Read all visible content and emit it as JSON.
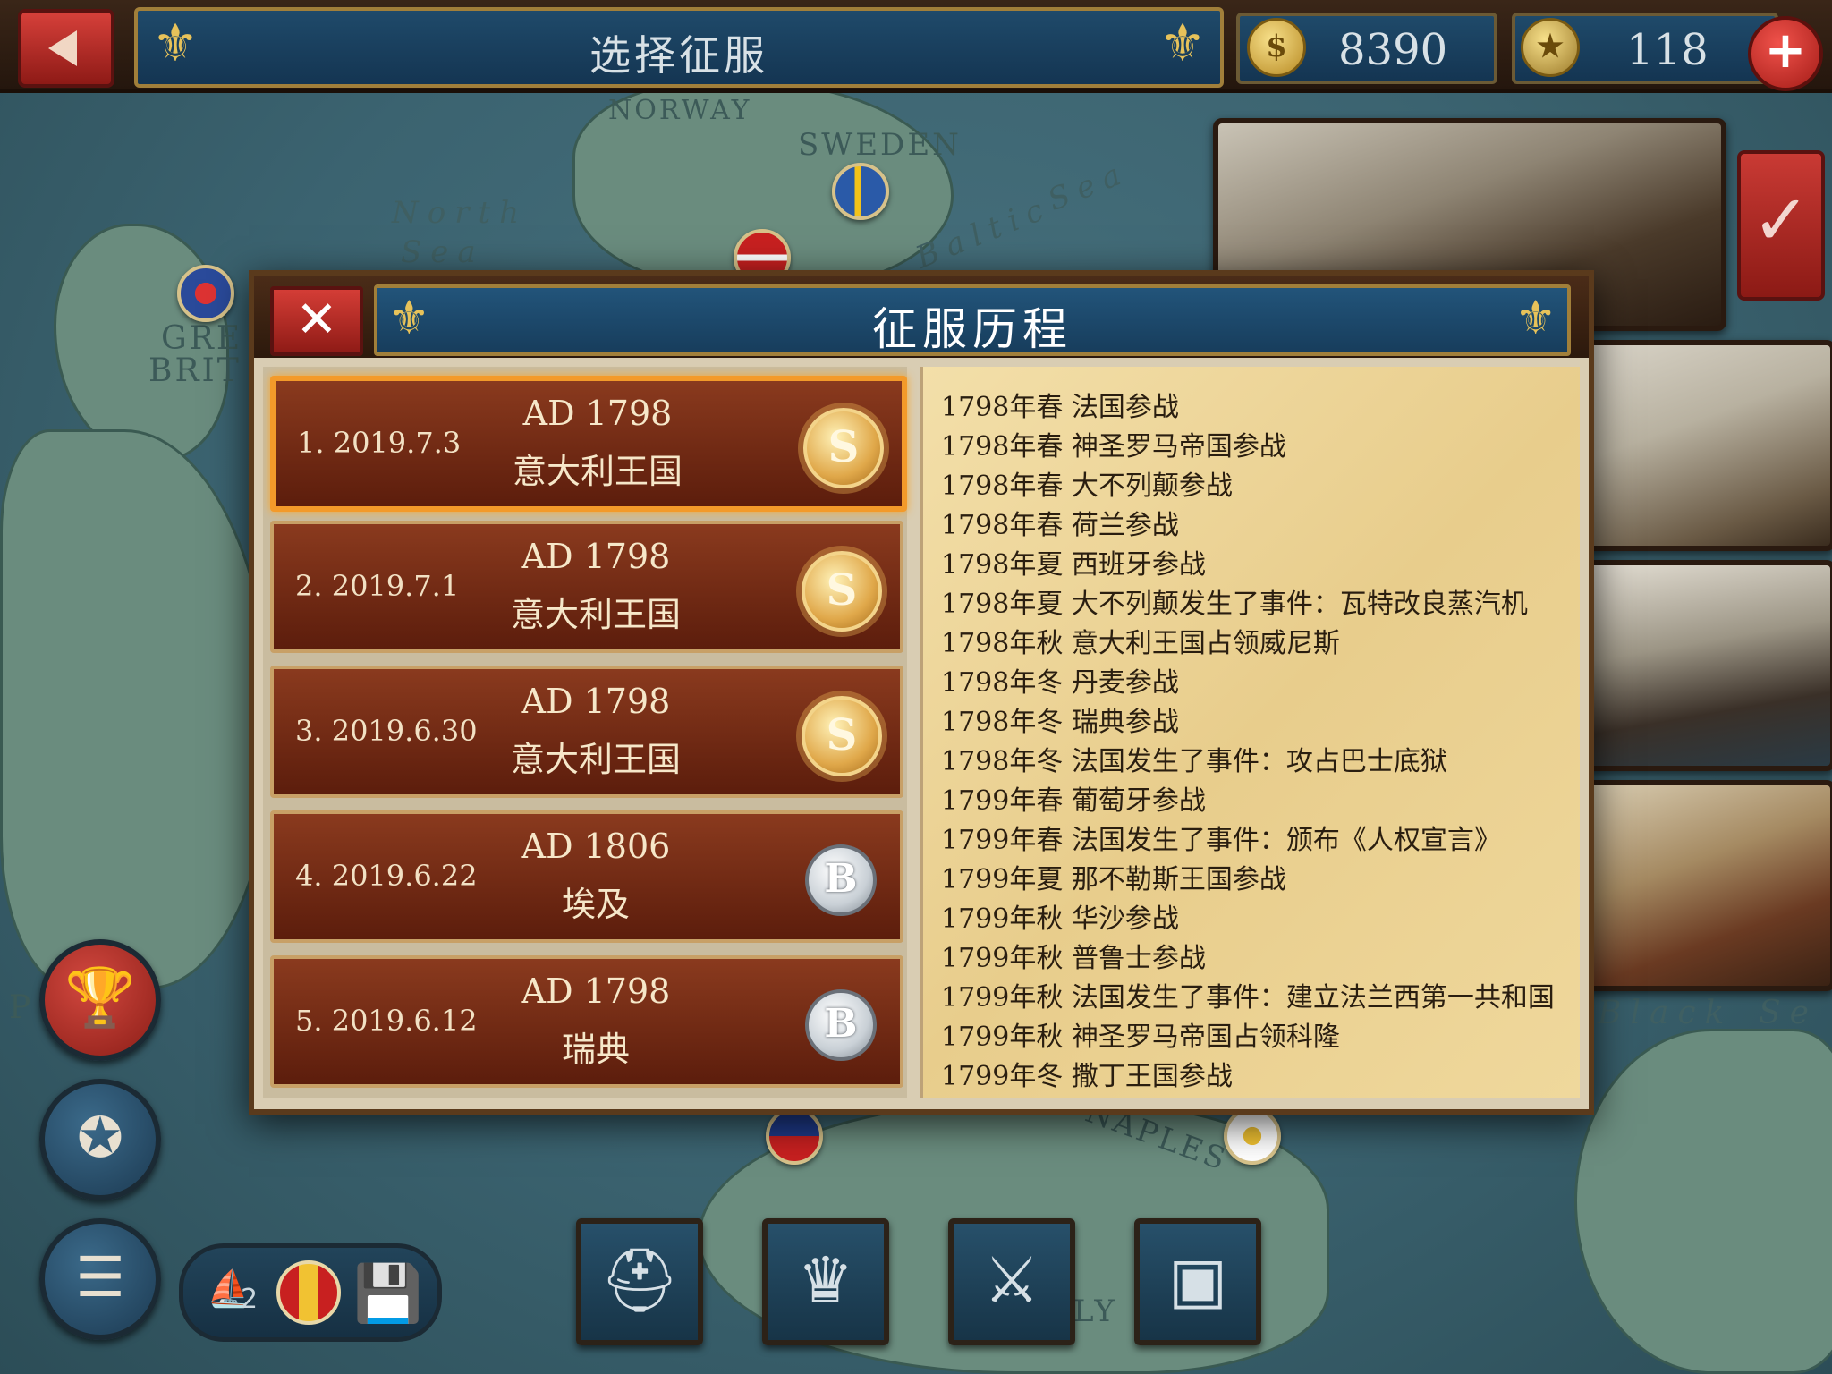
{
  "top_bar": {
    "title": "选择征服",
    "gold": "8390",
    "medals": "118",
    "plus_label": "+"
  },
  "map": {
    "labels": [
      "NORWAY",
      "SWEDEN",
      "North",
      "Sea",
      "Baltic",
      "Sea",
      "GRE",
      "BRIT",
      "Black",
      "Se",
      "NAPLES",
      "LY",
      "P"
    ]
  },
  "modal": {
    "title": "征服历程",
    "close_label": "✕",
    "records": [
      {
        "index_date": "1. 2019.7.3",
        "year": "AD 1798",
        "nation": "意大利王国",
        "medal": "S",
        "selected": true
      },
      {
        "index_date": "2. 2019.7.1",
        "year": "AD 1798",
        "nation": "意大利王国",
        "medal": "S",
        "selected": false
      },
      {
        "index_date": "3. 2019.6.30",
        "year": "AD 1798",
        "nation": "意大利王国",
        "medal": "S",
        "selected": false
      },
      {
        "index_date": "4. 2019.6.22",
        "year": "AD 1806",
        "nation": "埃及",
        "medal": "B",
        "selected": false
      },
      {
        "index_date": "5. 2019.6.12",
        "year": "AD 1798",
        "nation": "瑞典",
        "medal": "B",
        "selected": false
      }
    ],
    "log": [
      "1798年春 法国参战",
      "1798年春 神圣罗马帝国参战",
      "1798年春 大不列颠参战",
      "1798年春 荷兰参战",
      "1798年夏 西班牙参战",
      "1798年夏 大不列颠发生了事件：瓦特改良蒸汽机",
      "1798年秋 意大利王国占领威尼斯",
      "1798年冬 丹麦参战",
      "1798年冬 瑞典参战",
      "1798年冬 法国发生了事件：攻占巴士底狱",
      "1799年春 葡萄牙参战",
      "1799年春 法国发生了事件：颁布《人权宣言》",
      "1799年夏 那不勒斯王国参战",
      "1799年秋 华沙参战",
      "1799年秋 普鲁士参战",
      "1799年秋 法国发生了事件：建立法兰西第一共和国",
      "1799年秋 神圣罗马帝国占领科隆",
      "1799年冬 撒丁王国参战"
    ]
  },
  "bottom_bar": {
    "fleet_count": "2"
  },
  "colors": {
    "accent_red": "#c93a34",
    "panel_blue": "#1f4a6a",
    "gold_trim": "#a17f3a",
    "parchment": "#f3dfa9",
    "selected_glow": "#f39a2a"
  },
  "icons": [
    "back-arrow-icon",
    "fleur-de-lis-icon",
    "gold-coin-icon",
    "medal-icon",
    "plus-icon",
    "checkmark-icon",
    "close-icon",
    "s-medal-icon",
    "b-medal-icon",
    "trophy-icon",
    "badge-icon",
    "scroll-icon",
    "ship-icon",
    "flag-icon",
    "save-icon",
    "general-icon",
    "crown-icon",
    "military-icon",
    "chest-icon"
  ]
}
